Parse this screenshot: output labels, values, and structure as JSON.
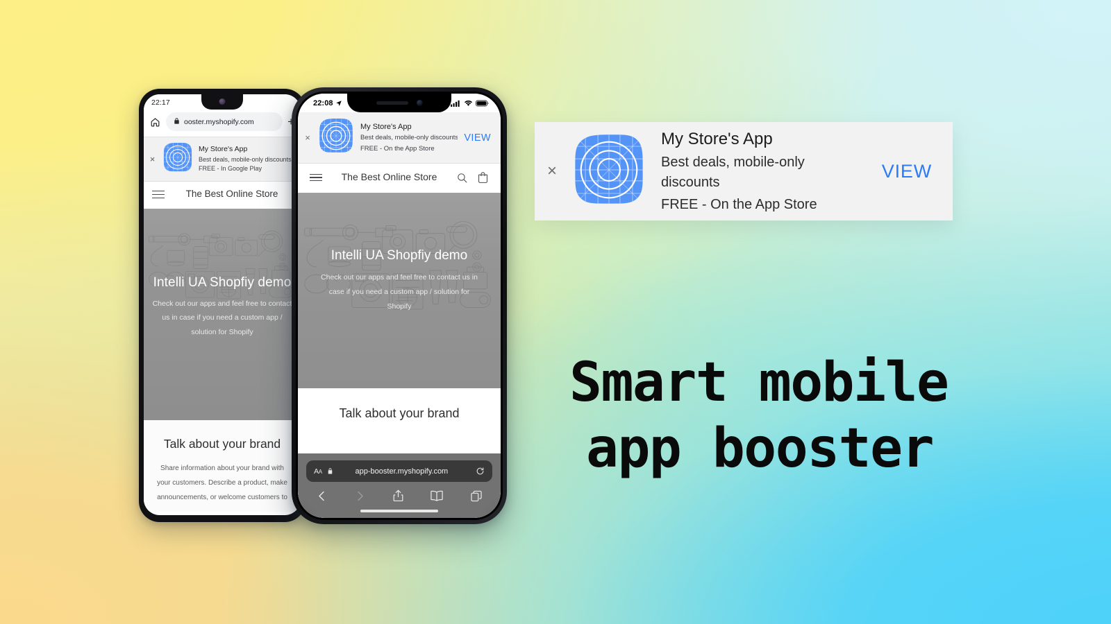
{
  "background": {
    "gradient_from": "#FDEF85",
    "gradient_mid": "#C6EBB2",
    "gradient_to": "#4ED2FA",
    "corner_top_left": "#FCEE8C",
    "corner_top_right": "#D2F3F9",
    "corner_bottom_left": "#FBD98C",
    "corner_bottom_right": "#4DD2F9"
  },
  "headline": {
    "line1": "Smart mobile",
    "line2": "app booster"
  },
  "app": {
    "name": "My Store's App",
    "tagline": "Best deals, mobile-only discounts",
    "price_ios": "FREE - On the App Store",
    "price_android": "FREE - In Google Play",
    "view_label": "VIEW",
    "close_label": "×",
    "accent_color": "#2B7CF6",
    "icon_color": "#5594F7",
    "icon_name": "app-grid-circles-icon"
  },
  "android_phone": {
    "status": {
      "time": "22:17"
    },
    "browser": {
      "home_icon": "home-icon",
      "lock_icon": "lock-icon",
      "url": "ooster.myshopify.com",
      "new_tab_label": "+"
    },
    "store_header": {
      "menu_icon": "hamburger-menu-icon",
      "title": "The Best Online Store"
    },
    "hero": {
      "title": "Intelli UA Shopfiy demo",
      "subtitle": "Check out our apps and feel free to contact us in case if you need a custom app / solution for Shopify"
    },
    "brand": {
      "title": "Talk about your brand",
      "body": "Share information about your brand with your customers. Describe a product, make announcements, or welcome customers to"
    }
  },
  "iphone": {
    "status": {
      "time": "22:08",
      "location_icon": "location-arrow-icon",
      "signal_icon": "cellular-signal-icon",
      "wifi_icon": "wifi-icon",
      "battery_icon": "battery-full-icon"
    },
    "store_header": {
      "menu_icon": "hamburger-menu-icon",
      "title": "The Best Online Store",
      "search_icon": "search-icon",
      "cart_icon": "shopping-bag-icon"
    },
    "hero": {
      "title": "Intelli UA Shopfiy demo",
      "subtitle": "Check out our apps and feel free to contact us in case if you need a custom app / solution for Shopify"
    },
    "brand": {
      "title": "Talk about your brand"
    },
    "safari": {
      "text_size_label": "AA",
      "lock_icon": "lock-icon",
      "url": "app-booster.myshopify.com",
      "reload_icon": "reload-icon",
      "back_icon": "chevron-left-icon",
      "forward_icon": "chevron-right-icon",
      "share_icon": "share-icon",
      "bookmarks_icon": "book-icon",
      "tabs_icon": "tabs-icon"
    }
  },
  "promo_card": {
    "close_label": "×",
    "title": "My Store's App",
    "subtitle": "Best deals, mobile-only discounts",
    "price": "FREE - On the App Store",
    "view_label": "VIEW"
  }
}
